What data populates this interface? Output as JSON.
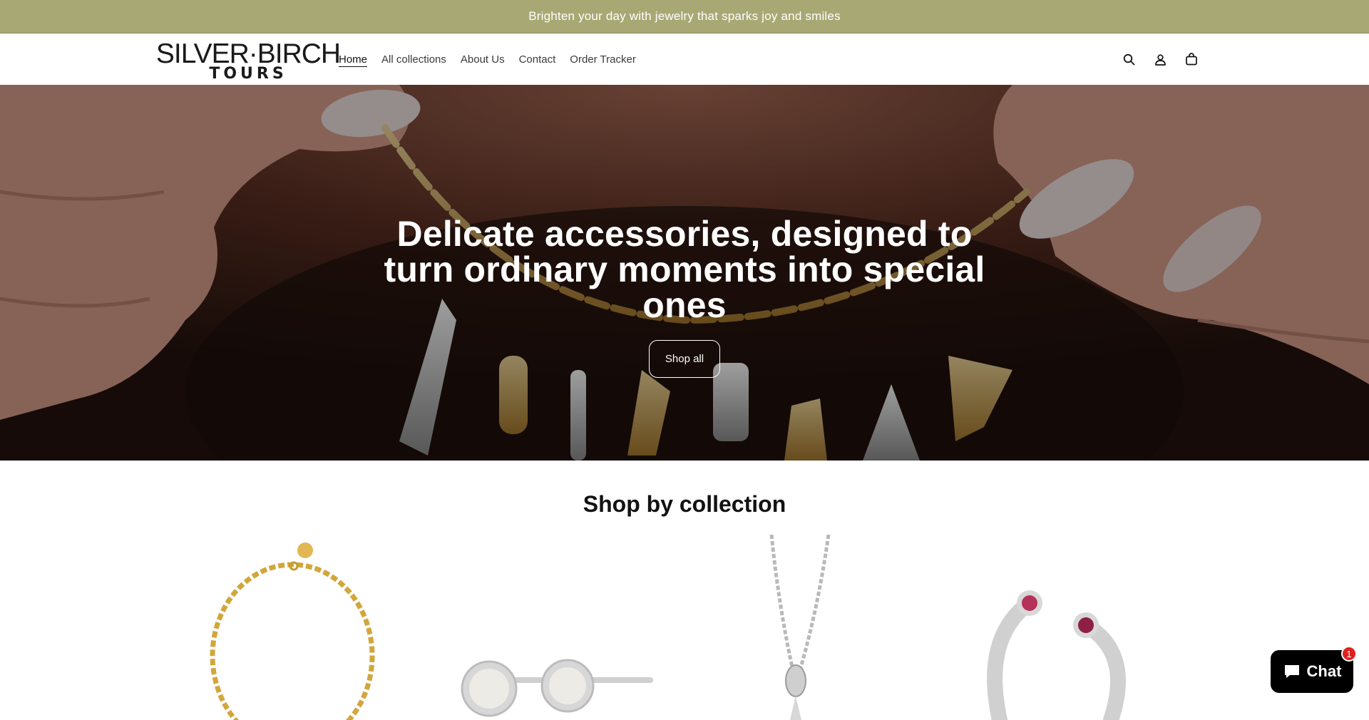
{
  "announcement": {
    "text": "Brighten your day with jewelry that sparks joy and smiles"
  },
  "logo": {
    "line1": "SILVER·BIRCH",
    "line2": "TOURS"
  },
  "nav": {
    "items": [
      {
        "label": "Home",
        "active": true
      },
      {
        "label": "All collections",
        "active": false
      },
      {
        "label": "About Us",
        "active": false
      },
      {
        "label": "Contact",
        "active": false
      },
      {
        "label": "Order Tracker",
        "active": false
      }
    ]
  },
  "header_icons": [
    "search-icon",
    "account-icon",
    "cart-icon"
  ],
  "hero": {
    "title": "Delicate accessories, designed to turn ordinary moments into special ones",
    "button_label": "Shop all"
  },
  "collections": {
    "title": "Shop by collection",
    "items": [
      {
        "icon": "gold-chain-bracelet-image"
      },
      {
        "icon": "silver-stud-earrings-image"
      },
      {
        "icon": "silver-pendant-necklace-image"
      },
      {
        "icon": "silver-gem-ring-image"
      }
    ]
  },
  "chat": {
    "label": "Chat",
    "badge": "1"
  },
  "colors": {
    "announcement_bg": "#a8a874",
    "chat_bg": "#000000",
    "badge": "#e0201f"
  }
}
